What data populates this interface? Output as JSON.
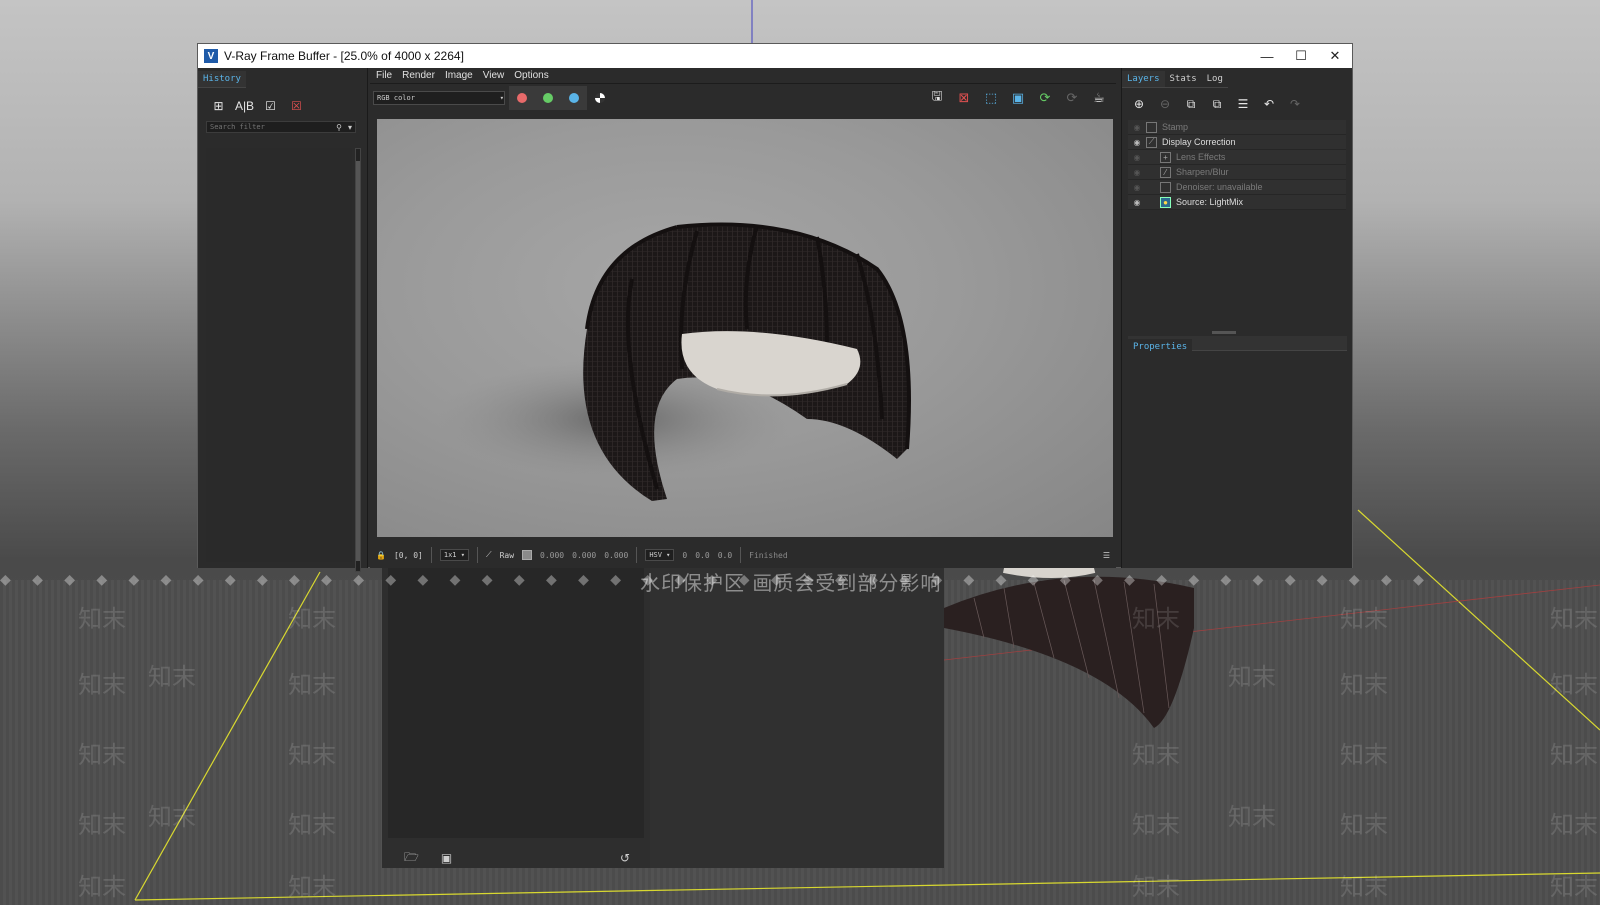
{
  "window": {
    "title": "V-Ray Frame Buffer - [25.0% of 4000 x 2264]",
    "app_icon_letter": "V",
    "controls": {
      "minimize": "—",
      "maximize": "☐",
      "close": "✕"
    }
  },
  "history": {
    "tab_label": "History",
    "tools": [
      "save-history-icon",
      "ab-compare-icon",
      "load-history-icon",
      "remove-history-icon"
    ],
    "search_placeholder": "Search filter",
    "search_icon": "search-icon"
  },
  "menu": {
    "items": [
      "File",
      "Render",
      "Image",
      "View",
      "Options"
    ]
  },
  "toolbar": {
    "channel": "RGB color",
    "channel_colors": {
      "red": "#e86a6a",
      "green": "#66cc66",
      "blue": "#5ab4e8"
    },
    "right_tools": [
      "save-image-icon",
      "clear-image-icon",
      "region-render-icon",
      "track-mouse-icon",
      "render-icon",
      "render-interactive-icon",
      "stop-render-icon"
    ]
  },
  "status": {
    "coords": "[0, 0]",
    "zoom": "1x1",
    "color_mode": "Raw",
    "rgb_r": "0.000",
    "rgb_g": "0.000",
    "rgb_b": "0.000",
    "space": "HSV",
    "h": "0",
    "s": "0.0",
    "v": "0.0",
    "state": "Finished"
  },
  "right_panel": {
    "tabs": [
      "Layers",
      "Stats",
      "Log"
    ],
    "layers": [
      {
        "label": "Stamp",
        "visible": false,
        "indent": false
      },
      {
        "label": "Display Correction",
        "visible": true,
        "indent": false
      },
      {
        "label": "Lens Effects",
        "visible": false,
        "indent": true
      },
      {
        "label": "Sharpen/Blur",
        "visible": false,
        "indent": true
      },
      {
        "label": "Denoiser: unavailable",
        "visible": false,
        "indent": true
      },
      {
        "label": "Source: LightMix",
        "visible": true,
        "indent": true
      }
    ],
    "properties_label": "Properties"
  },
  "background": {
    "watermark_notice": "水印保护区  画质会受到部分影响",
    "watermark_text": "知末"
  }
}
